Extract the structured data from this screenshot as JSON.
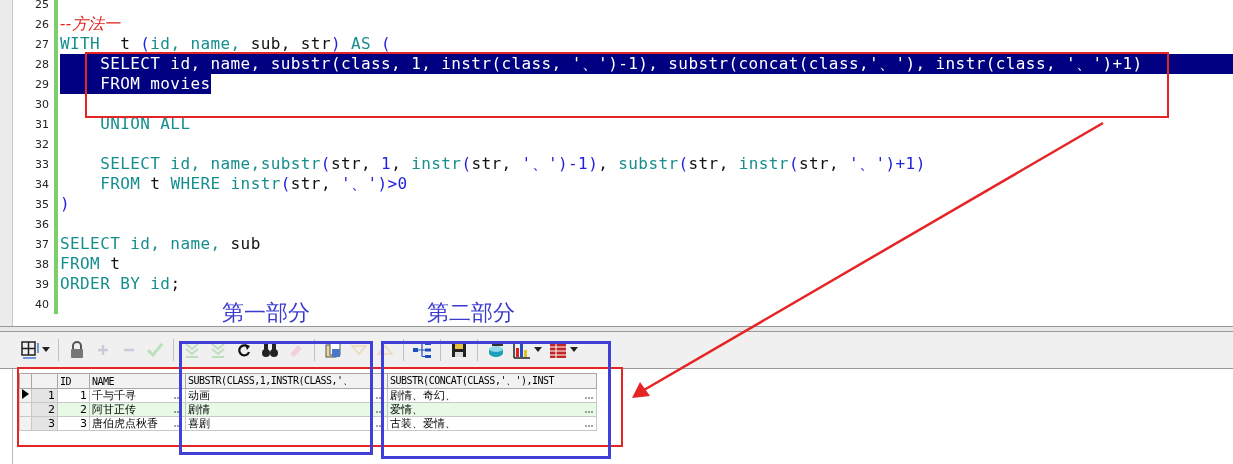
{
  "editor": {
    "lines": [
      {
        "number": "25",
        "selected": false
      },
      {
        "number": "26",
        "selected": false,
        "tokens": [
          {
            "kind": "comment",
            "text": "--方法一"
          }
        ]
      },
      {
        "number": "27",
        "selected": false,
        "tokens": [
          {
            "kind": "keyword",
            "text": "WITH  "
          },
          {
            "kind": "plain",
            "text": "t "
          },
          {
            "kind": "symbol",
            "text": "("
          },
          {
            "kind": "keyword",
            "text": "id, name, "
          },
          {
            "kind": "plain",
            "text": "sub, str"
          },
          {
            "kind": "symbol",
            "text": ") "
          },
          {
            "kind": "keyword",
            "text": "AS "
          },
          {
            "kind": "symbol",
            "text": "("
          }
        ]
      },
      {
        "number": "28",
        "selected": true,
        "tokens": [
          {
            "kind": "plain",
            "text": "    SELECT id, name, substr(class, 1, instr(class, '、')-1), substr(concat(class,'、'), instr(class, '、')+1)"
          }
        ]
      },
      {
        "number": "29",
        "selected": true,
        "tokens": [
          {
            "kind": "plain",
            "text": "    FROM movies"
          }
        ]
      },
      {
        "number": "30",
        "selected": false
      },
      {
        "number": "31",
        "selected": false,
        "tokens": [
          {
            "kind": "keyword",
            "text": "    UNION ALL"
          }
        ]
      },
      {
        "number": "32",
        "selected": false
      },
      {
        "number": "33",
        "selected": false,
        "tokens": [
          {
            "kind": "keyword",
            "text": "    SELECT id, name,substr"
          },
          {
            "kind": "symbol",
            "text": "("
          },
          {
            "kind": "plain",
            "text": "str, "
          },
          {
            "kind": "symbol",
            "text": "1"
          },
          {
            "kind": "plain",
            "text": ", "
          },
          {
            "kind": "keyword",
            "text": "instr"
          },
          {
            "kind": "symbol",
            "text": "("
          },
          {
            "kind": "plain",
            "text": "str, "
          },
          {
            "kind": "symbol",
            "text": "'、')-1)"
          },
          {
            "kind": "plain",
            "text": ", "
          },
          {
            "kind": "keyword",
            "text": "substr"
          },
          {
            "kind": "symbol",
            "text": "("
          },
          {
            "kind": "plain",
            "text": "str, "
          },
          {
            "kind": "keyword",
            "text": "instr"
          },
          {
            "kind": "symbol",
            "text": "("
          },
          {
            "kind": "plain",
            "text": "str, "
          },
          {
            "kind": "symbol",
            "text": "'、')+1)"
          }
        ]
      },
      {
        "number": "34",
        "selected": false,
        "tokens": [
          {
            "kind": "keyword",
            "text": "    FROM "
          },
          {
            "kind": "plain",
            "text": "t "
          },
          {
            "kind": "keyword",
            "text": "WHERE instr"
          },
          {
            "kind": "symbol",
            "text": "("
          },
          {
            "kind": "plain",
            "text": "str, "
          },
          {
            "kind": "symbol",
            "text": "'、')>0"
          }
        ]
      },
      {
        "number": "35",
        "selected": false,
        "tokens": [
          {
            "kind": "symbol",
            "text": ")"
          }
        ]
      },
      {
        "number": "36",
        "selected": false
      },
      {
        "number": "37",
        "selected": false,
        "tokens": [
          {
            "kind": "keyword",
            "text": "SELECT id, name, "
          },
          {
            "kind": "plain",
            "text": "sub"
          }
        ]
      },
      {
        "number": "38",
        "selected": false,
        "tokens": [
          {
            "kind": "keyword",
            "text": "FROM "
          },
          {
            "kind": "plain",
            "text": "t"
          }
        ]
      },
      {
        "number": "39",
        "selected": false,
        "tokens": [
          {
            "kind": "keyword",
            "text": "ORDER BY id"
          },
          {
            "kind": "plain",
            "text": ";"
          }
        ]
      },
      {
        "number": "40",
        "selected": false
      }
    ]
  },
  "toolbar": [
    {
      "kind": "grid",
      "disabled": false,
      "caret": true
    },
    {
      "kind": "separator"
    },
    {
      "kind": "lock",
      "disabled": false,
      "caret": false
    },
    {
      "kind": "plus",
      "disabled": true,
      "caret": false
    },
    {
      "kind": "minus",
      "disabled": true,
      "caret": false
    },
    {
      "kind": "check",
      "disabled": true,
      "caret": false
    },
    {
      "kind": "separator"
    },
    {
      "kind": "down",
      "disabled": true,
      "caret": false
    },
    {
      "kind": "down",
      "disabled": true,
      "caret": false
    },
    {
      "kind": "refresh",
      "disabled": false,
      "caret": false
    },
    {
      "kind": "binoculars",
      "disabled": false,
      "caret": false
    },
    {
      "kind": "eraser",
      "disabled": true,
      "caret": false
    },
    {
      "kind": "separator"
    },
    {
      "kind": "pages",
      "disabled": false,
      "caret": false
    },
    {
      "kind": "tri-down",
      "disabled": true,
      "caret": false
    },
    {
      "kind": "tri-up",
      "disabled": true,
      "caret": false
    },
    {
      "kind": "separator"
    },
    {
      "kind": "tree",
      "disabled": false,
      "caret": false
    },
    {
      "kind": "separator"
    },
    {
      "kind": "save",
      "disabled": false,
      "caret": false
    },
    {
      "kind": "separator"
    },
    {
      "kind": "database",
      "disabled": false,
      "caret": false
    },
    {
      "kind": "chart",
      "disabled": false,
      "caret": true
    },
    {
      "kind": "table",
      "disabled": false,
      "caret": true
    }
  ],
  "grid": {
    "columns": [
      "ID",
      "NAME",
      "SUBSTR(CLASS,1,INSTR(CLASS,'、",
      "SUBSTR(CONCAT(CLASS,'、'),INST"
    ],
    "rows": [
      {
        "number": "1",
        "current": true,
        "cells": [
          "1",
          "千与千寻",
          "动画",
          "剧情、奇幻、"
        ]
      },
      {
        "number": "2",
        "current": false,
        "cells": [
          "2",
          "阿甘正传",
          "剧情",
          "爱情、"
        ]
      },
      {
        "number": "3",
        "current": false,
        "cells": [
          "3",
          "唐伯虎点秋香",
          "喜剧",
          "古装、爱情、"
        ]
      }
    ]
  },
  "annotations": {
    "labels": [
      "第一部分",
      "第二部分"
    ]
  }
}
